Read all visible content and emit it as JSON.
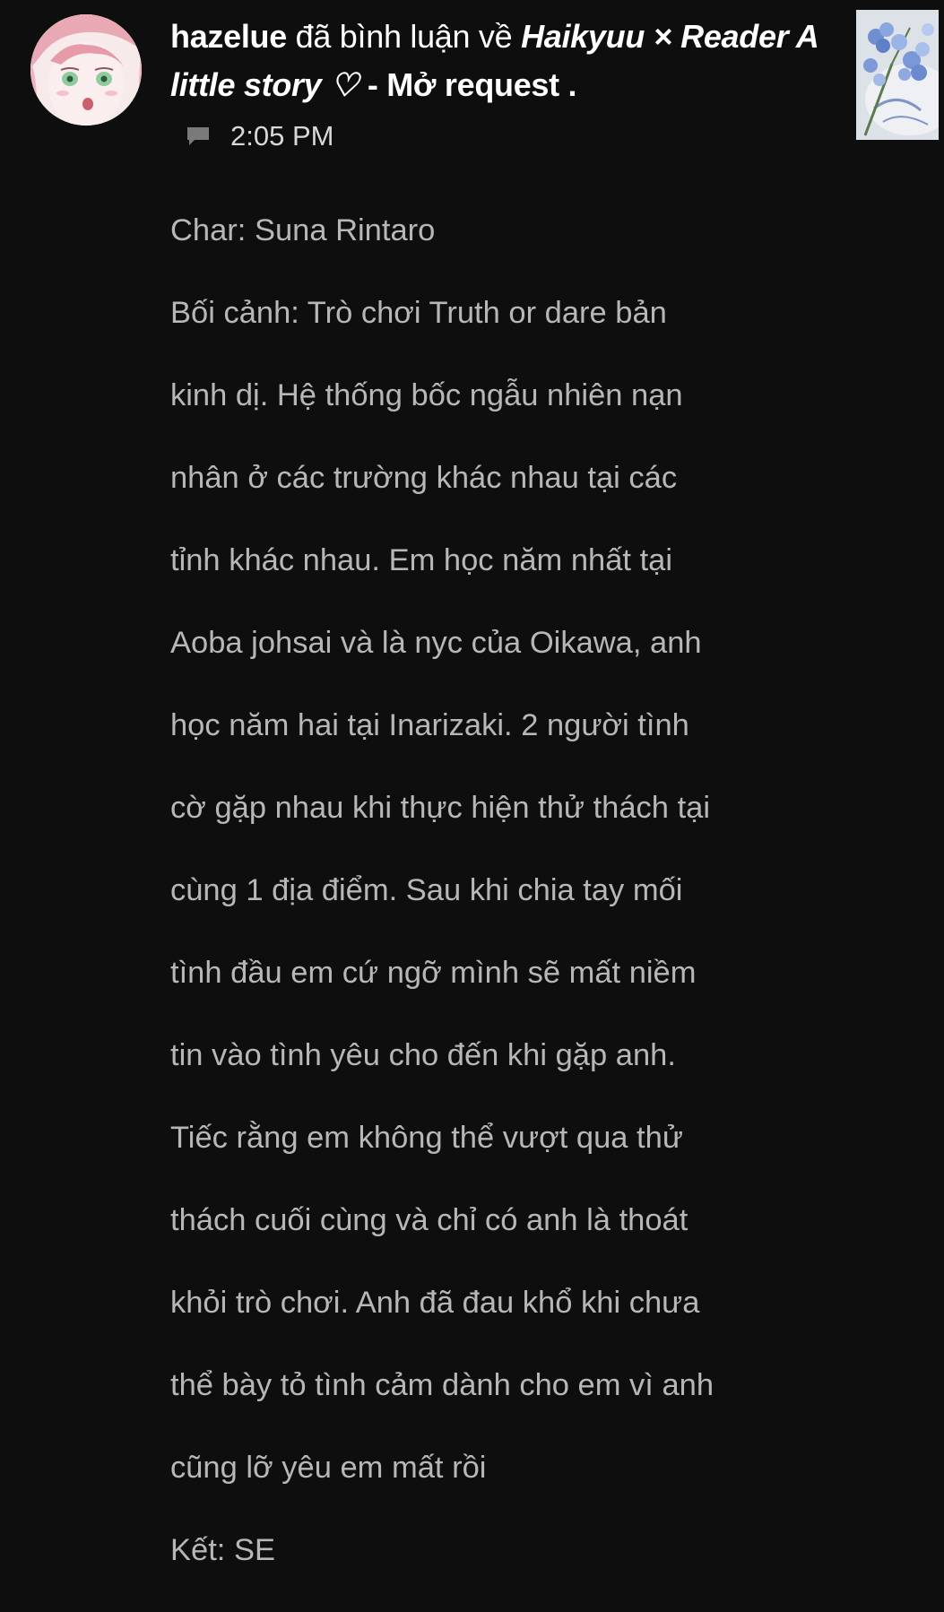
{
  "notification": {
    "username": "hazelue",
    "action_text": " đã bình luận về ",
    "story_title": "Haikyuu × Reader A little story ♡",
    "separator": " - ",
    "chapter_title": "Mở request",
    "trailing": " .",
    "time": "2:05 PM",
    "type_icon": "comment-icon"
  },
  "comment": {
    "lines": [
      "Char: Suna Rintaro",
      "Bối cảnh: Trò chơi Truth or dare bản",
      "kinh dị. Hệ thống bốc ngẫu nhiên nạn",
      "nhân ở các trường khác nhau tại các",
      "tỉnh khác nhau. Em học năm nhất tại",
      "Aoba johsai và là nyc của Oikawa, anh",
      "học năm hai tại Inarizaki. 2 người tình",
      "cờ gặp nhau khi thực hiện thử thách tại",
      "cùng 1 địa điểm. Sau khi chia tay mối",
      "tình đầu em cứ ngỡ mình sẽ mất niềm",
      "tin vào tình yêu cho đến khi gặp anh.",
      "Tiếc rằng em không thể vượt qua thử",
      "thách cuối cùng và chỉ có anh là thoát",
      "khỏi trò chơi. Anh đã đau khổ khi chưa",
      "thể bày tỏ tình cảm dành cho em vì anh",
      "cũng lỡ yêu em mất rồi",
      "Kết: SE"
    ]
  },
  "colors": {
    "background": "#0e0e0e",
    "header_text": "#ffffff",
    "body_text": "#b7b7b7",
    "meta_text": "#d8d8d8"
  }
}
